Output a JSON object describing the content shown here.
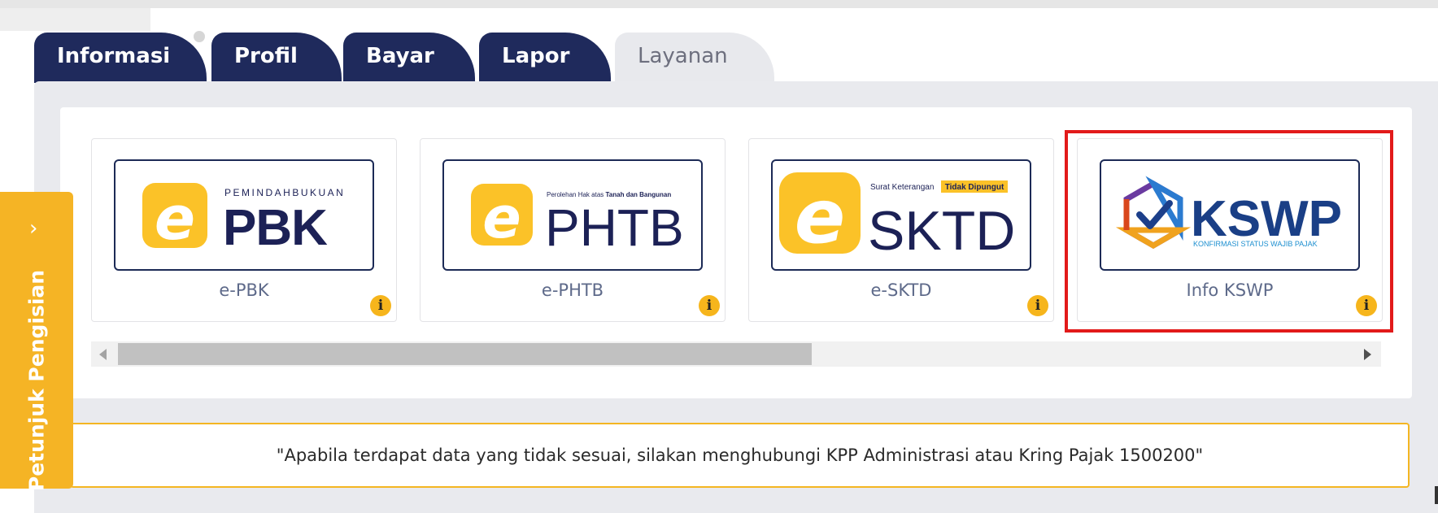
{
  "tabs": [
    {
      "label": "Informasi",
      "active": true
    },
    {
      "label": "Profil",
      "active": true
    },
    {
      "label": "Bayar",
      "active": true
    },
    {
      "label": "Lapor",
      "active": true
    },
    {
      "label": "Layanan",
      "active": false
    }
  ],
  "cards": [
    {
      "label": "e-PBK",
      "logo": {
        "tag": "PEMINDAHBUKUAN",
        "name": "PBK",
        "letter": "e"
      }
    },
    {
      "label": "e-PHTB",
      "logo": {
        "tag_prefix": "Perolehan Hak atas ",
        "tag_bold": "Tanah dan Bangunan",
        "name": "PHTB",
        "letter": "e"
      }
    },
    {
      "label": "e-SKTD",
      "logo": {
        "tag": "Surat Keterangan",
        "tag_badge": "Tidak Dipungut",
        "name": "SKTD",
        "letter": "e"
      }
    },
    {
      "label": "Info KSWP",
      "logo": {
        "name": "KSWP",
        "tag": "KONFIRMASI STATUS WAJIB PAJAK"
      },
      "highlighted": true
    }
  ],
  "info_icon": "i",
  "notice": "\"Apabila terdapat data yang tidak sesuai, silakan menghubungi KPP Administrasi atau Kring Pajak 1500200\"",
  "side_tab": {
    "label": "Petunjuk Pengisian",
    "chevron": "›"
  },
  "colors": {
    "navy": "#1f2a5c",
    "accent": "#f5b425",
    "highlight": "#e21a1a"
  }
}
